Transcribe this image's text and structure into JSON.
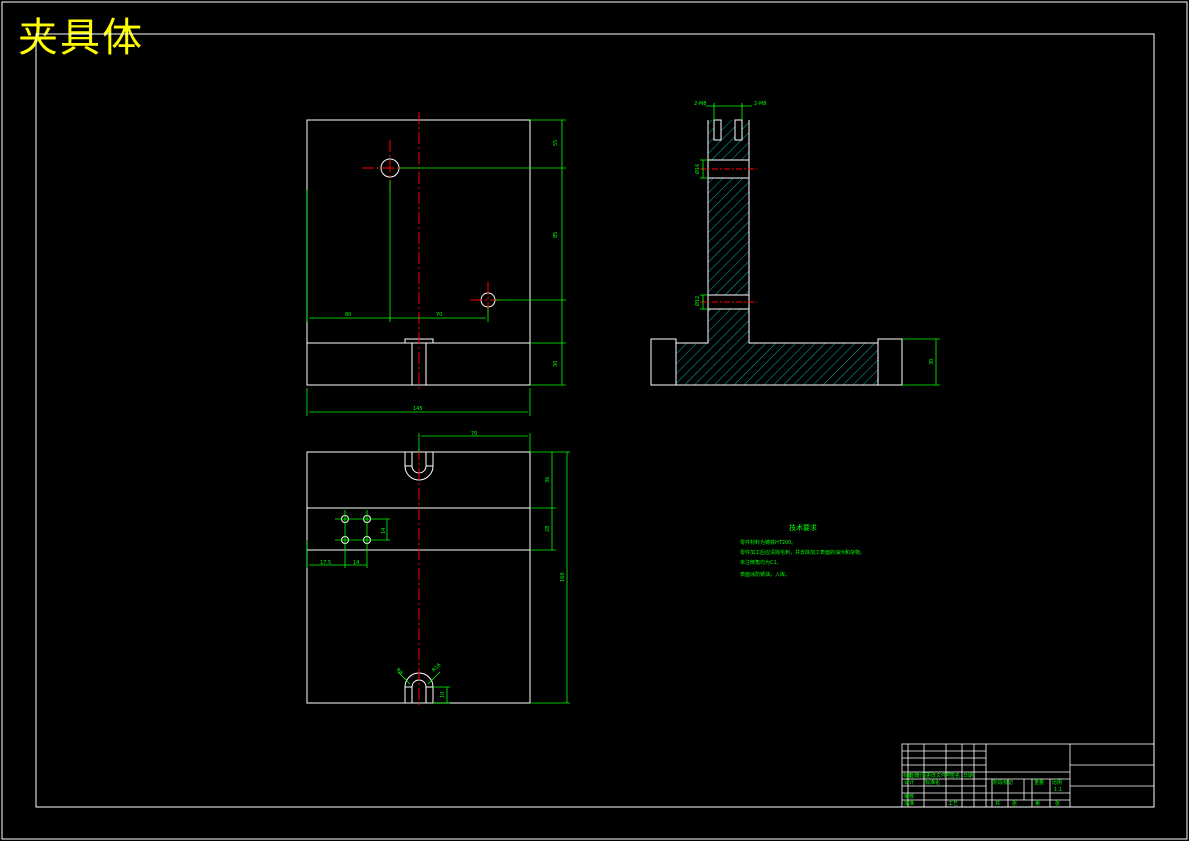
{
  "drawing": {
    "title": "夹具体"
  },
  "dims": {
    "front_top_right": "55",
    "front_mid_right": "85",
    "front_left_h": "80",
    "front_right_h": "70",
    "front_base_right": "30",
    "front_total_width": "145",
    "side_top_left": "2-M8",
    "side_top_right": "2-M8",
    "side_hole1": "Ø16",
    "side_hole2": "Ø12",
    "side_base_h": "30",
    "plan_top_width": "70",
    "plan_right_1": "36",
    "plan_right_2": "28",
    "plan_total_h": "160",
    "plan_left_a": "17.5",
    "plan_left_b": "14",
    "plan_small_v": "14",
    "plan_bottom_left": "R8",
    "plan_bottom_right": "R16",
    "plan_bottom_small": "10"
  },
  "tech": {
    "heading": "技术要求",
    "lines": [
      "零件材料为铸铁HT200。",
      "零件加工后应清除毛刺，并去除加工表面的油污和杂物。",
      "未注倒角均为C1。",
      "表面涂防锈油，入库。"
    ]
  },
  "titleblock": {
    "labels": [
      "标记",
      "处数",
      "分区",
      "更改文件号",
      "签名",
      "日期"
    ],
    "row2": [
      "设计",
      "标准化",
      "阶段标记",
      "重量",
      "比例"
    ],
    "row3": [
      "审核",
      "工艺",
      "批准",
      "共",
      "张",
      "第",
      "张"
    ],
    "scale": "1:1"
  },
  "colors": {
    "outline": "#ffffff",
    "dimension": "#00ff00",
    "centerline": "#ff0000",
    "hatch": "#00ffff",
    "title": "#ffff00"
  }
}
